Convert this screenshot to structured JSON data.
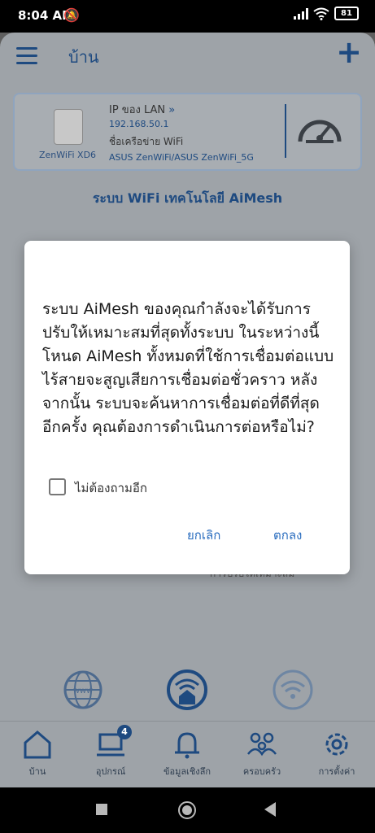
{
  "status_bar": {
    "time": "8:04 AM",
    "battery": "81"
  },
  "header": {
    "title": "บ้าน"
  },
  "router_card": {
    "model": "ZenWiFi XD6",
    "lan_label": "IP ของ LAN",
    "lan_chevron": "»",
    "ip": "192.168.50.1",
    "network_label": "ชื่อเครือข่าย WiFi",
    "ssid": "ASUS ZenWiFi/ASUS ZenWiFi_5G"
  },
  "aimesh_heading": "ระบบ WiFi เทคโนโลยี AiMesh",
  "background_partial_text": "การปรับให้เหมาะสม",
  "dialog": {
    "message": "ระบบ AiMesh ของคุณกำลังจะได้รับการปรับให้เหมาะสมที่สุดทั้งระบบ ในระหว่างนี้ โหนด AiMesh ทั้งหมดที่ใช้การเชื่อมต่อแบบไร้สายจะสูญเสียการเชื่อมต่อชั่วคราว หลังจากนั้น ระบบจะค้นหาการเชื่อมต่อที่ดีที่สุดอีกครั้ง คุณต้องการดำเนินการต่อหรือไม่?",
    "checkbox_label": "ไม่ต้องถามอีก",
    "cancel_label": "ยกเลิก",
    "ok_label": "ตกลง"
  },
  "bottom_nav": {
    "home": "บ้าน",
    "devices": "อุปกรณ์",
    "devices_badge": "4",
    "notifications": "ข้อมูลเชิงลึก",
    "family": "ครอบครัว",
    "settings": "การตั้งค่า"
  },
  "colors": {
    "accent": "#1e4a80",
    "dialog_button": "#2a6dbf"
  }
}
